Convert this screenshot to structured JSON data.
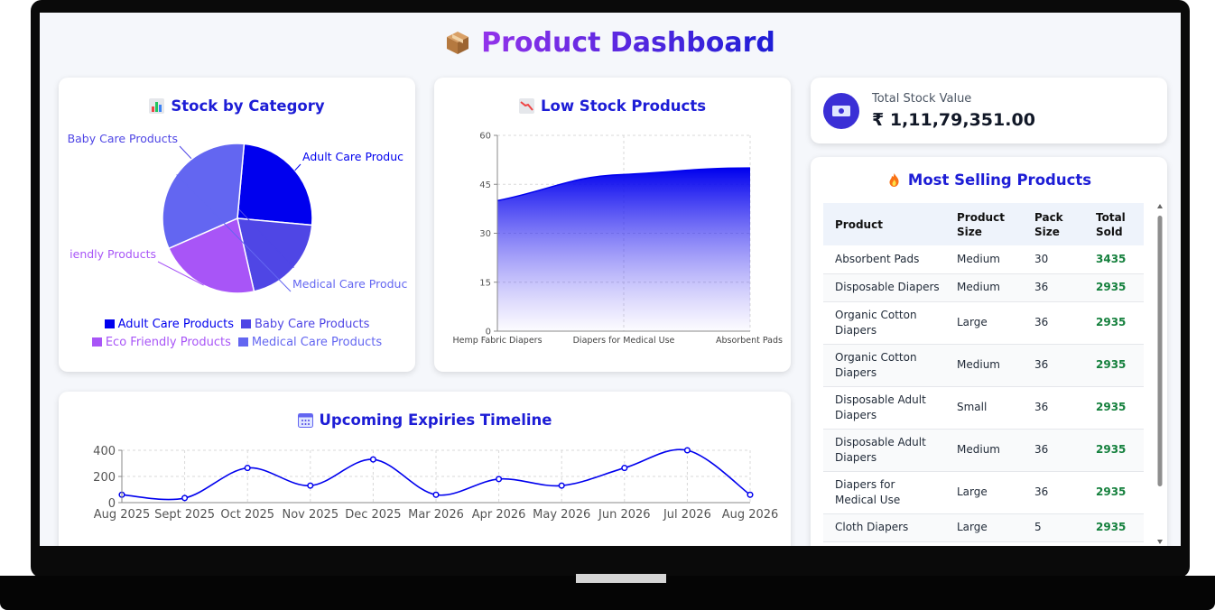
{
  "page": {
    "title": "Product Dashboard",
    "title_icon": "package-icon"
  },
  "stock_by_category": {
    "title": "Stock by Category",
    "icon": "bar-chart-icon",
    "chart_data": {
      "type": "pie",
      "categories": [
        "Adult Care Products",
        "Baby Care Products",
        "Eco Friendly Products",
        "Medical Care Products"
      ],
      "values": [
        25,
        20,
        22,
        33
      ],
      "colors": [
        "#0000ee",
        "#4f46e5",
        "#a855f7",
        "#6366f1"
      ],
      "slice_labels": [
        "Adult Care Produc",
        "Baby Care Products",
        "iendly Products",
        "Medical Care Produc"
      ]
    },
    "legend": [
      {
        "label": "Adult Care Products",
        "color": "#0000ee"
      },
      {
        "label": "Baby Care Products",
        "color": "#4f46e5"
      },
      {
        "label": "Eco Friendly Products",
        "color": "#a855f7"
      },
      {
        "label": "Medical Care Products",
        "color": "#6366f1"
      }
    ]
  },
  "low_stock": {
    "title": "Low Stock Products",
    "icon": "chart-decreasing-icon",
    "chart_data": {
      "type": "area",
      "categories": [
        "Hemp Fabric Diapers",
        "Diapers for Medical Use",
        "Absorbent Pads"
      ],
      "values": [
        40,
        48,
        50
      ],
      "ylim": [
        0,
        60
      ],
      "yticks": [
        "0",
        "15",
        "30",
        "45",
        "60"
      ],
      "grid": true,
      "color": "#0000ee"
    }
  },
  "total_stock": {
    "label": "Total Stock Value",
    "value": "₹ 1,11,79,351.00",
    "icon": "money-icon"
  },
  "most_selling": {
    "title": "Most Selling Products",
    "icon": "fire-icon",
    "columns": [
      "Product",
      "Product Size",
      "Pack Size",
      "Total Sold"
    ],
    "rows": [
      {
        "product": "Absorbent Pads",
        "size": "Medium",
        "pack": "30",
        "sold": "3435"
      },
      {
        "product": "Disposable Diapers",
        "size": "Medium",
        "pack": "36",
        "sold": "2935"
      },
      {
        "product": "Organic Cotton Diapers",
        "size": "Large",
        "pack": "36",
        "sold": "2935"
      },
      {
        "product": "Organic Cotton Diapers",
        "size": "Medium",
        "pack": "36",
        "sold": "2935"
      },
      {
        "product": "Disposable Adult Diapers",
        "size": "Small",
        "pack": "36",
        "sold": "2935"
      },
      {
        "product": "Disposable Adult Diapers",
        "size": "Medium",
        "pack": "36",
        "sold": "2935"
      },
      {
        "product": "Diapers for Medical Use",
        "size": "Large",
        "pack": "36",
        "sold": "2935"
      },
      {
        "product": "Cloth Diapers",
        "size": "Large",
        "pack": "5",
        "sold": "2935"
      }
    ]
  },
  "expiries": {
    "title": "Upcoming Expiries Timeline",
    "icon": "calendar-icon",
    "chart_data": {
      "type": "line",
      "x": [
        "Aug 2025",
        "Sept 2025",
        "Oct 2025",
        "Nov 2025",
        "Dec 2025",
        "Mar 2026",
        "Apr 2026",
        "May 2026",
        "Jun 2026",
        "Jul 2026",
        "Aug 2026"
      ],
      "values": [
        60,
        35,
        265,
        130,
        330,
        60,
        180,
        130,
        265,
        400,
        60
      ],
      "ylim": [
        0,
        400
      ],
      "yticks": [
        "0",
        "200",
        "400"
      ],
      "grid": true,
      "color": "#0000ee"
    }
  }
}
